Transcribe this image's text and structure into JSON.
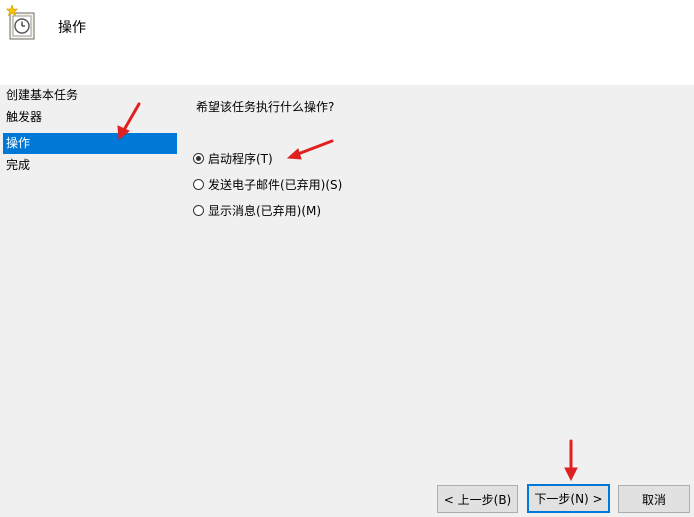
{
  "header": {
    "title": "操作",
    "icon": "task-clock-icon"
  },
  "sidebar": {
    "items": [
      {
        "label": "创建基本任务"
      },
      {
        "label": "触发器"
      },
      {
        "label": "操作"
      },
      {
        "label": "完成"
      }
    ],
    "active_index": 2
  },
  "main": {
    "question": "希望该任务执行什么操作?",
    "options": [
      {
        "label": "启动程序(T)",
        "checked": true
      },
      {
        "label": "发送电子邮件(已弃用)(S)",
        "checked": false
      },
      {
        "label": "显示消息(已弃用)(M)",
        "checked": false
      }
    ]
  },
  "buttons": {
    "back": "< 上一步(B)",
    "next": "下一步(N) >",
    "cancel": "取消"
  },
  "colors": {
    "selection": "#0078d7",
    "annotation_arrow": "#e02020"
  }
}
